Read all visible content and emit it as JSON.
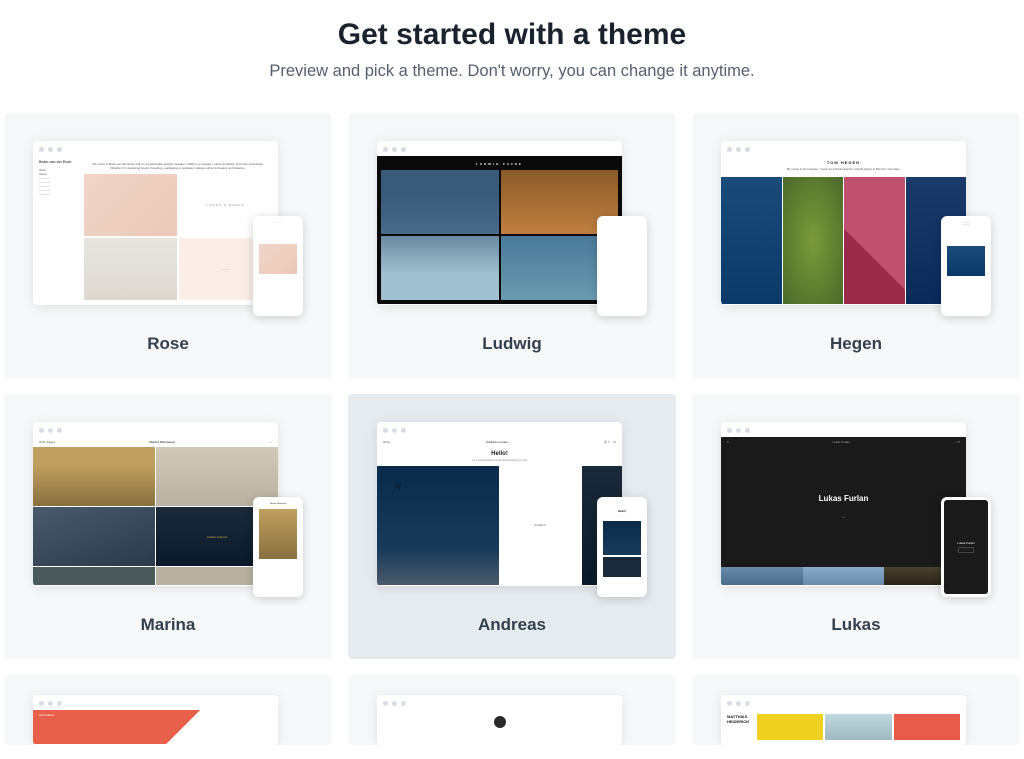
{
  "header": {
    "title": "Get started with a theme",
    "subtitle": "Preview and pick a theme. Don't worry, you can change it anytime."
  },
  "themes": [
    {
      "id": "rose",
      "name": "Rose",
      "selected": false,
      "preview": {
        "author": "Beam van der Ende",
        "intro": "My name is Rose van der Ende and I'm a passionate graphic designer. Within my designs I value simplicity, symmetry and detail. Whether I'm designing books, branding, packaging or websites I always strive for beauty and balance.",
        "tile_label": "LOGOS & MARKS"
      }
    },
    {
      "id": "ludwig",
      "name": "Ludwig",
      "selected": false,
      "preview": {
        "header": "LUDWIG FAVRE"
      }
    },
    {
      "id": "hegen",
      "name": "Hegen",
      "selected": false,
      "preview": {
        "name": "TOM HEGEN",
        "desc": "My name is Tom Hegen, I work as a Photographer and Designer in Munich, Germany."
      }
    },
    {
      "id": "marina",
      "name": "Marina",
      "selected": false,
      "preview": {
        "nav_left": "Work   Pages",
        "nav_center": "Marina Weishaupt",
        "caption": "Golden Autumn",
        "phone_header": "Marina Weishaupt"
      }
    },
    {
      "id": "andreas",
      "name": "Andreas",
      "selected": true,
      "preview": {
        "nav_left": "Work",
        "nav_center": "Andreas Levers",
        "hello": "Hello!",
        "sub": "I'm a visual designer & like photographing at night",
        "tile_label": "At Night #"
      }
    },
    {
      "id": "lukas",
      "name": "Lukas",
      "selected": false,
      "preview": {
        "nav_center": "Lukas Furlan",
        "hero": "Lukas Furlan",
        "phone_name": "Lukas Furlan"
      }
    },
    {
      "id": "row3a",
      "name": "",
      "partial": true,
      "preview": {
        "nav_left": "work   about",
        "nav_right": "— —"
      }
    },
    {
      "id": "row3b",
      "name": "",
      "partial": true,
      "preview": {}
    },
    {
      "id": "row3c",
      "name": "",
      "partial": true,
      "preview": {
        "name_line1": "MATTHIAS",
        "name_line2": "HEIDERICH"
      }
    }
  ]
}
